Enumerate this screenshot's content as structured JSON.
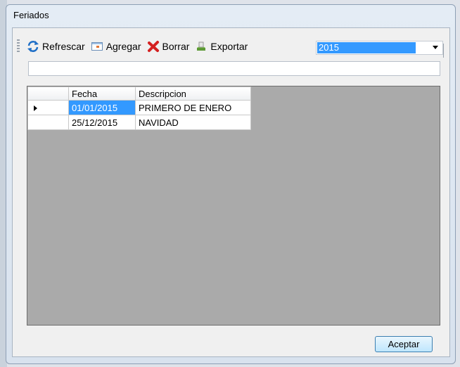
{
  "window": {
    "title": "Feriados"
  },
  "toolbar": {
    "refresh_label": "Refrescar",
    "add_label": "Agregar",
    "delete_label": "Borrar",
    "export_label": "Exportar",
    "year_selected": "2015"
  },
  "filter": {
    "value": ""
  },
  "grid": {
    "columns": [
      "Fecha",
      "Descripcion"
    ],
    "rows": [
      {
        "fecha": "01/01/2015",
        "descripcion": "PRIMERO DE ENERO",
        "current": true
      },
      {
        "fecha": "25/12/2015",
        "descripcion": "NAVIDAD",
        "current": false
      }
    ]
  },
  "footer": {
    "accept_label": "Aceptar"
  },
  "colors": {
    "selection": "#3399ff",
    "grid_background": "#aaaaaa",
    "delete_icon": "#d42020"
  },
  "icons": [
    "refresh-icon",
    "add-icon",
    "delete-icon",
    "export-icon",
    "chevron-down-icon",
    "row-pointer-icon"
  ]
}
